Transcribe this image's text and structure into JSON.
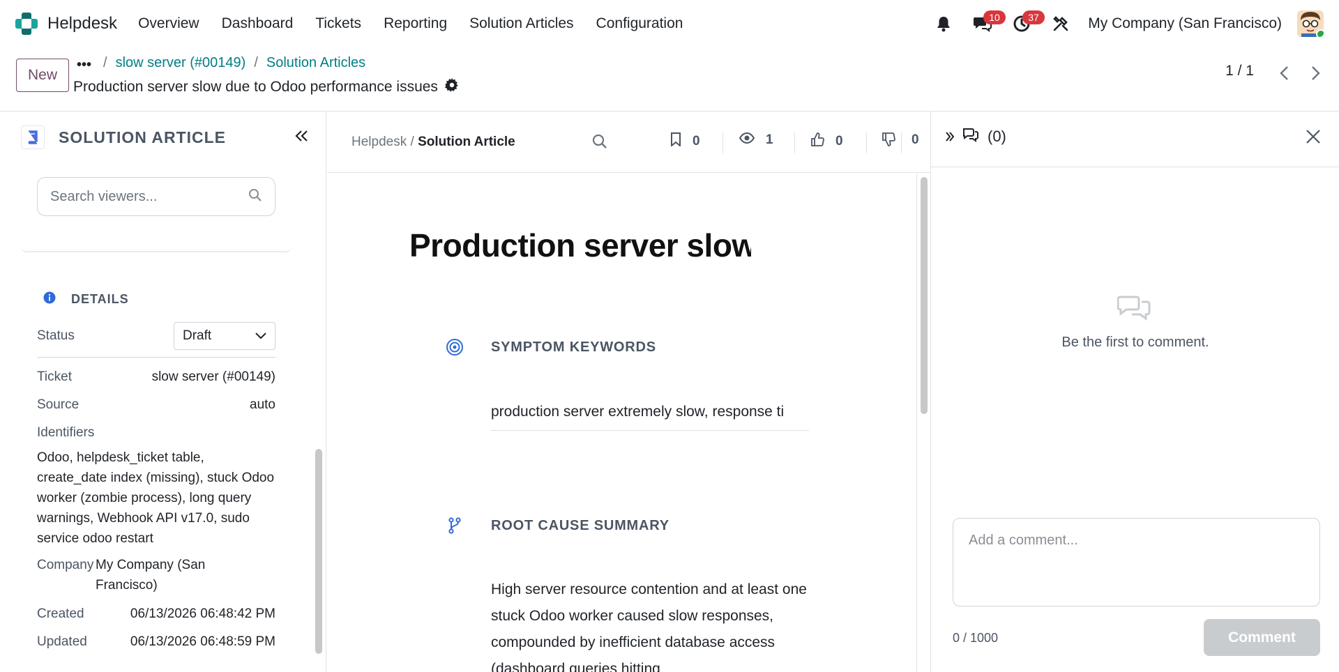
{
  "navbar": {
    "app_name": "Helpdesk",
    "menu": [
      "Overview",
      "Dashboard",
      "Tickets",
      "Reporting",
      "Solution Articles",
      "Configuration"
    ],
    "messages_badge": "10",
    "activities_badge": "37",
    "company": "My Company (San Francisco)",
    "colors": {
      "logo_teal": "#1aa59a",
      "logo_dark": "#0f6e6a",
      "badge": "#d9363e"
    }
  },
  "control": {
    "new_label": "New",
    "more_label": "•••",
    "breadcrumb_sep": "/",
    "breadcrumbs": [
      "slow server (#00149)",
      "Solution Articles"
    ],
    "record_title": "Production server slow due to Odoo performance issues",
    "pager": "1 / 1"
  },
  "left_panel": {
    "title": "SOLUTION ARTICLE",
    "search_placeholder": "Search viewers...",
    "details_title": "DETAILS",
    "status_label": "Status",
    "status_value": "Draft",
    "ticket_label": "Ticket",
    "ticket_value": "slow server (#00149)",
    "source_label": "Source",
    "source_value": "auto",
    "identifiers_label": "Identifiers",
    "identifiers_value": "Odoo, helpdesk_ticket table, create_date index (missing), stuck Odoo worker (zombie process), long query warnings, Webhook API v17.0, sudo service odoo restart",
    "company_label": "Company",
    "company_value": "My Company (San Francisco)",
    "created_label": "Created",
    "created_value": "06/13/2026 06:48:42 PM",
    "updated_label": "Updated",
    "updated_value": "06/13/2026 06:48:59 PM"
  },
  "center": {
    "crumb_root": "Helpdesk /",
    "crumb_current": "Solution Article",
    "bookmarks": "0",
    "views": "1",
    "likes": "0",
    "dislikes": "0",
    "article_title": "Production server slow due t",
    "section1_title": "SYMPTOM KEYWORDS",
    "section1_text": "production server extremely slow, response ti",
    "section2_title": "ROOT CAUSE SUMMARY",
    "section2_text": "High server resource contention and at least one stuck Odoo worker caused slow responses, compounded by inefficient database access (dashboard queries hitting",
    "accent": "#2e6bd6"
  },
  "chatter": {
    "count_label": "(0)",
    "empty_text": "Be the first to comment.",
    "comment_placeholder": "Add a comment...",
    "char_count": "0 / 1000",
    "comment_button": "Comment"
  }
}
